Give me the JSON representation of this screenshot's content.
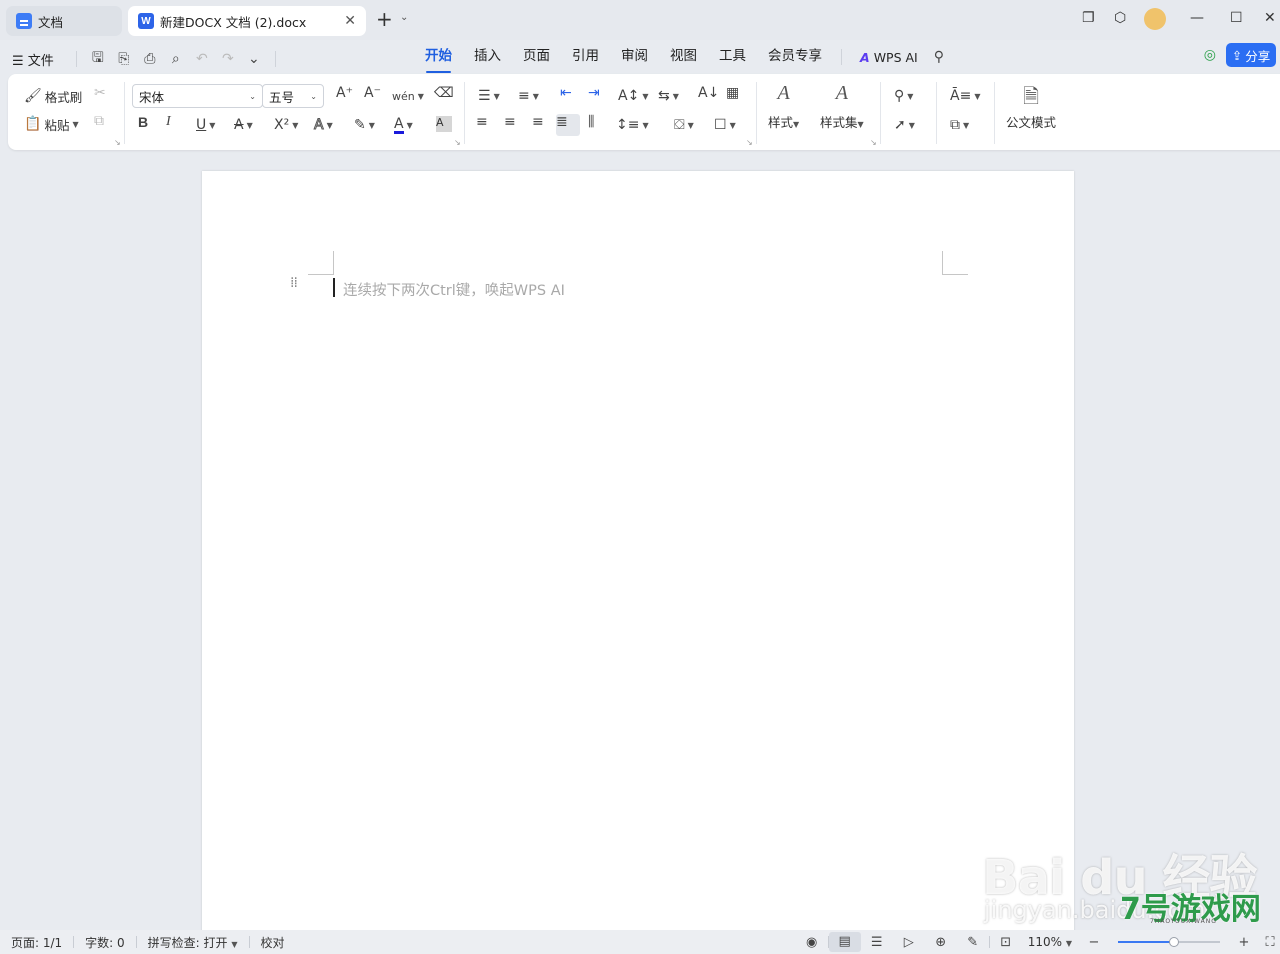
{
  "tabs": {
    "docs_label": "文档",
    "active_label": "新建DOCX 文档 (2).docx",
    "word_icon_letter": "W"
  },
  "menu": {
    "file_label": "文件",
    "ribbon_tabs": [
      "开始",
      "插入",
      "页面",
      "引用",
      "审阅",
      "视图",
      "工具",
      "会员专享"
    ],
    "active_tab": "开始",
    "wps_ai_label": "WPS AI",
    "share_label": "分享"
  },
  "ribbon": {
    "format_painter_label": "格式刷",
    "paste_label": "粘贴",
    "font_name": "宋体",
    "font_size": "五号",
    "styles_label": "样式",
    "style_set_label": "样式集",
    "official_mode_label": "公文模式",
    "bold": "B",
    "italic": "I",
    "underline": "U",
    "strikethrough": "A",
    "superscript": "X²",
    "font_color": "A",
    "char_shading": "A",
    "text_effect": "A",
    "grow_font": "A⁺",
    "shrink_font": "A⁻",
    "pinyin": "wén",
    "sort": "A↓"
  },
  "document": {
    "placeholder": "连续按下两次Ctrl键，唤起WPS AI"
  },
  "status": {
    "page": "页面: 1/1",
    "word_count": "字数: 0",
    "spell_check": "拼写检查: 打开",
    "proofread": "校对",
    "zoom": "110%",
    "zoom_fraction": 0.55
  },
  "watermark": {
    "baidu": "Bai du 经验",
    "url": "jingyan.baidu.com",
    "site": "7号游戏网",
    "site_sub": "7HAOYOUXIWANG"
  },
  "colors": {
    "accent": "#1f5fe0",
    "share_bg": "#2b6ef3",
    "font_color_bar": "#1a1adb"
  }
}
